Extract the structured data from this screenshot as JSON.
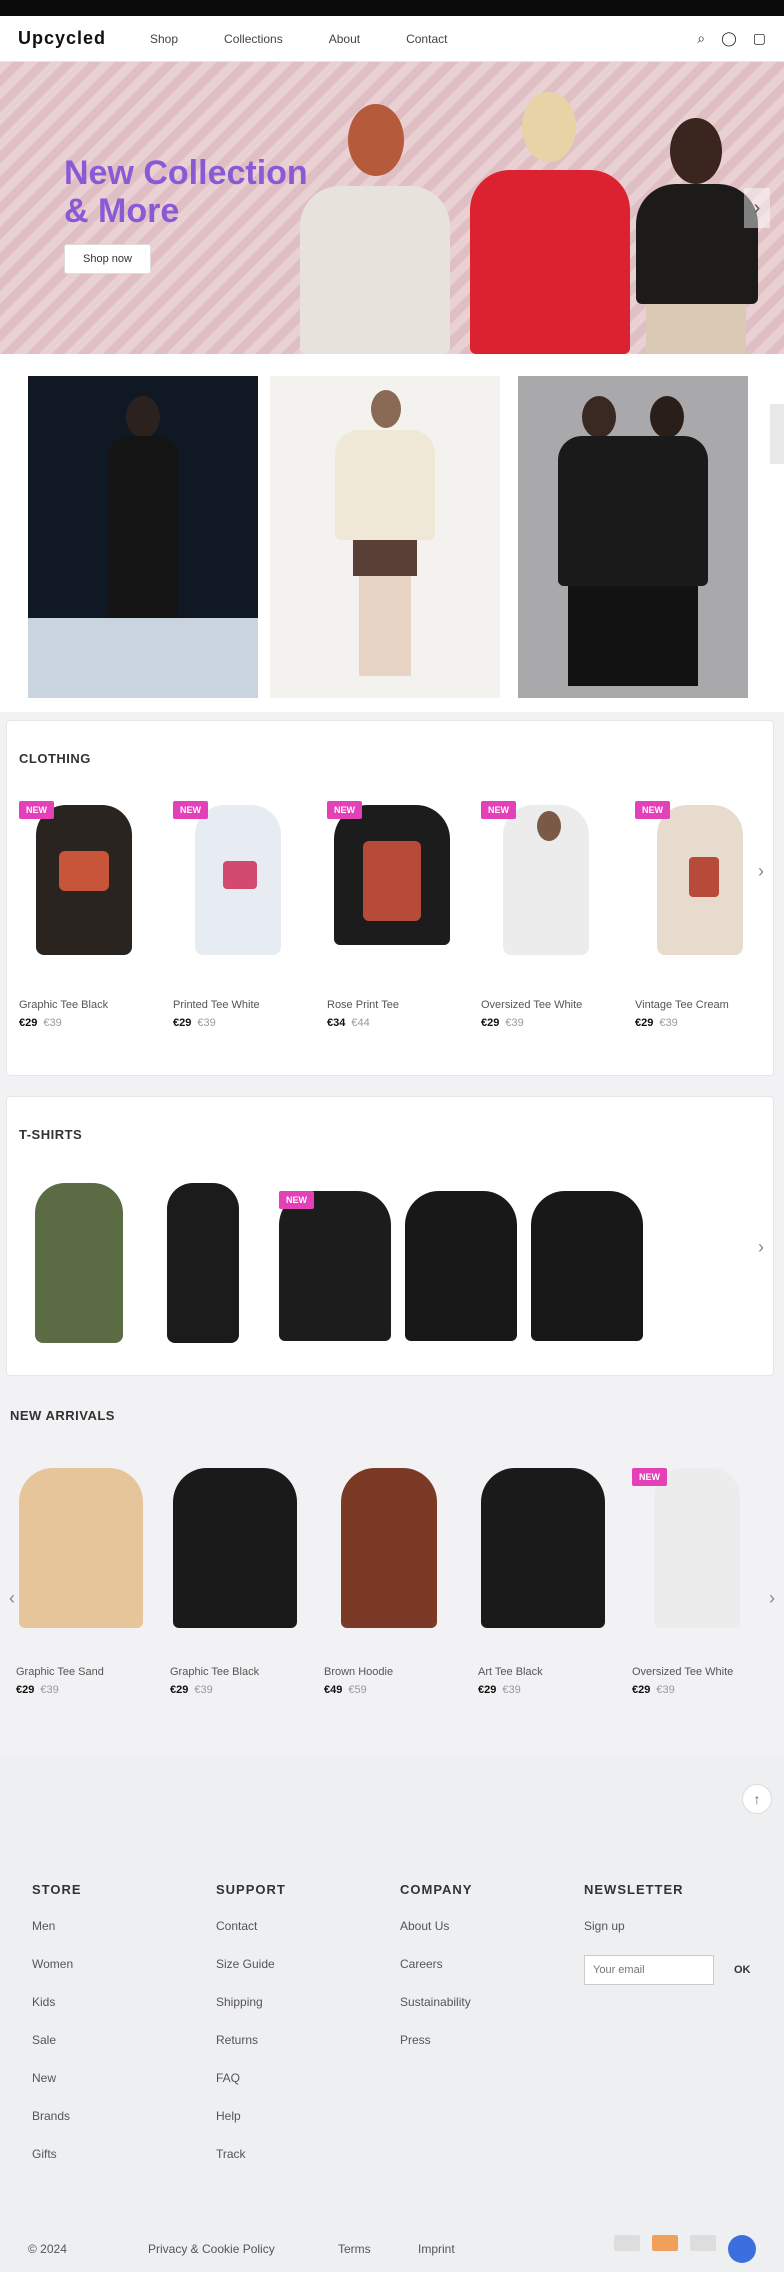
{
  "nav": {
    "logo": "Upcycled",
    "links": [
      "Shop",
      "Collections",
      "About",
      "Contact"
    ],
    "icons": [
      "search-icon",
      "user-icon",
      "cart-icon"
    ]
  },
  "hero": {
    "title": "New Collection & More",
    "button": "Shop now",
    "arrow": "›"
  },
  "sections": {
    "s1": {
      "title": "CLOTHING",
      "products": [
        {
          "name": "Graphic Tee Black",
          "price": "€29",
          "old": "€39",
          "badge": "NEW"
        },
        {
          "name": "Printed Tee White",
          "price": "€29",
          "old": "€39",
          "badge": "NEW"
        },
        {
          "name": "Rose Print Tee",
          "price": "€34",
          "old": "€44",
          "badge": "NEW"
        },
        {
          "name": "Oversized Tee White",
          "price": "€29",
          "old": "€39",
          "badge": "NEW"
        },
        {
          "name": "Vintage Tee Cream",
          "price": "€29",
          "old": "€39",
          "badge": "NEW"
        }
      ]
    },
    "s2": {
      "title": "T-SHIRTS",
      "badge": "NEW"
    },
    "s3": {
      "title": "NEW ARRIVALS",
      "products": [
        {
          "name": "Graphic Tee Sand",
          "price": "€29",
          "old": "€39"
        },
        {
          "name": "Graphic Tee Black",
          "price": "€29",
          "old": "€39"
        },
        {
          "name": "Brown Hoodie",
          "price": "€49",
          "old": "€59"
        },
        {
          "name": "Art Tee Black",
          "price": "€29",
          "old": "€39"
        },
        {
          "name": "Oversized Tee White",
          "price": "€29",
          "old": "€39",
          "badge": "NEW"
        }
      ]
    }
  },
  "footer": {
    "cols": [
      {
        "head": "STORE",
        "links": [
          "Men",
          "Women",
          "Kids",
          "Sale",
          "New",
          "Brands",
          "Gifts"
        ]
      },
      {
        "head": "SUPPORT",
        "links": [
          "Contact",
          "Size Guide",
          "Shipping",
          "Returns",
          "FAQ",
          "Help",
          "Track"
        ]
      },
      {
        "head": "COMPANY",
        "links": [
          "About Us",
          "Careers",
          "Sustainability",
          "Press"
        ]
      }
    ],
    "newsletter": {
      "head": "NEWSLETTER",
      "text": "Sign up",
      "placeholder": "Your email",
      "button": "OK"
    },
    "bottom": {
      "copyright": "© 2024",
      "privacy": "Privacy & Cookie Policy",
      "terms": "Terms",
      "imprint": "Imprint"
    },
    "scroll_top": "↑"
  },
  "colors": {
    "badge": "#e440b8",
    "hero_title": "#8a5ad6",
    "footer_bg": "#eeeff1"
  }
}
